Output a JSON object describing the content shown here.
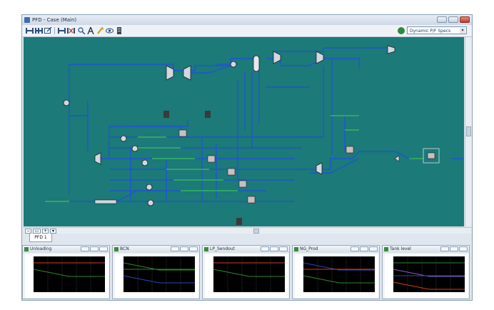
{
  "window": {
    "title": "PFD - Case (Main)"
  },
  "toolbar": {
    "icons": [
      "pfd-add-icon",
      "pfd-split-icon",
      "pfd-export-icon",
      "pfd-connect-icon",
      "pfd-break-icon",
      "zoom-icon",
      "text-icon",
      "color-icon",
      "view-icon",
      "bars-icon"
    ],
    "spec_option": "Dynamic P/F Specs"
  },
  "tabs": [
    "PFD 1"
  ],
  "panels": [
    {
      "title": "Unloading",
      "colors": [
        "#d43b2a",
        "#2a8a2a"
      ]
    },
    {
      "title": "BCN",
      "colors": [
        "#2a8a2a",
        "#2a8a2a",
        "#2a45c0"
      ]
    },
    {
      "title": "LP_Sendout",
      "colors": [
        "#d43b2a",
        "#2a8a2a"
      ]
    },
    {
      "title": "NG_Prod",
      "colors": [
        "#2a45c0",
        "#d43b2a",
        "#2a8a2a"
      ]
    },
    {
      "title": "Tank level",
      "colors": [
        "#2a8a2a",
        "#8a5ac0",
        "#2a45c0",
        "#d43b2a"
      ]
    }
  ],
  "colors": {
    "canvas": "#1c7a78",
    "pipe": "#1f55d0",
    "green_pipe": "#3ec83e"
  }
}
